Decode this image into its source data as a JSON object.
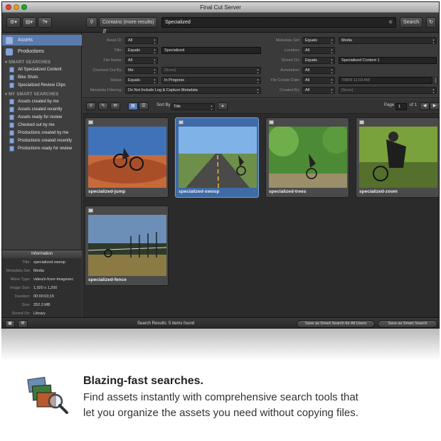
{
  "window": {
    "title": "Final Cut Server"
  },
  "toolbar": {
    "search_mode": "Contains (more results)",
    "search_value": "Specialized",
    "search_button": "Search"
  },
  "sidebar": {
    "items": [
      {
        "label": "Assets",
        "selected": true
      },
      {
        "label": "Productions",
        "selected": false
      }
    ],
    "smart_searches_header": "SMART SEARCHES",
    "smart_searches": [
      "All Specialized Content",
      "Bike Shots",
      "Specialized Review Clips"
    ],
    "my_smart_searches_header": "MY SMART SEARCHES",
    "my_smart_searches": [
      "Assets created by me",
      "Assets created recently",
      "Assets ready for review",
      "Checked out by me",
      "Productions created by me",
      "Productions created recently",
      "Productions ready for review"
    ]
  },
  "info_panel": {
    "header": "Information",
    "rows": [
      {
        "key": "Title:",
        "value": "specialized-swoop"
      },
      {
        "key": "Metadata Set:",
        "value": "Media"
      },
      {
        "key": "Mime Type:",
        "value": "video/x-fcsvr-imagesec"
      },
      {
        "key": "Image Size:",
        "value": "1,920 x 1,200"
      },
      {
        "key": "Duration:",
        "value": "00:00:03;15"
      },
      {
        "key": "Size:",
        "value": "252.3 MB"
      },
      {
        "key": "Stored On:",
        "value": "Library"
      }
    ]
  },
  "filters": {
    "asset_id": {
      "label": "Asset ID:",
      "value": "All"
    },
    "title": {
      "label": "Title:",
      "op": "Equals",
      "value": "Specialized"
    },
    "file_name": {
      "label": "File Name:",
      "value": "All"
    },
    "checked_out_by": {
      "label": "Checked Out By:",
      "op": "Me",
      "value": "[None]"
    },
    "status": {
      "label": "Status:",
      "op": "Equals",
      "value": "In Progress"
    },
    "metadata_filtering": {
      "label": "Metadata Filtering:",
      "value": "Do Not Include Log & Capture Metadata"
    },
    "metadata_set": {
      "label": "Metadata Set:",
      "op": "Equals",
      "value": "Media"
    },
    "location": {
      "label": "Location:",
      "value": "All"
    },
    "stored_on": {
      "label": "Stored On:",
      "op": "Equals",
      "value": "Specialized Content 1"
    },
    "annotation": {
      "label": "Annotation:",
      "value": "All"
    },
    "file_create_date": {
      "label": "File Create Date:",
      "op": "All",
      "value": "7/8/09 11:03 AM"
    },
    "created_by": {
      "label": "Created By:",
      "op": "All",
      "value": "[None]"
    }
  },
  "gridbar": {
    "sort_label": "Sort By",
    "sort_value": "Title",
    "page_label": "Page",
    "page_value": "1",
    "page_of": "of 1"
  },
  "assets": [
    {
      "label": "specialized-jump",
      "selected": false
    },
    {
      "label": "specialized-swoop",
      "selected": true
    },
    {
      "label": "specialized-trees",
      "selected": false
    },
    {
      "label": "specialized-zoom",
      "selected": false
    },
    {
      "label": "specialized-fence",
      "selected": false
    }
  ],
  "statusbar": {
    "results": "Search Results: 5 items found",
    "save_all": "Save as Smart Search for All Users",
    "save": "Save as Smart Search"
  },
  "promo": {
    "headline": "Blazing-fast searches.",
    "line1": "Find assets instantly with comprehensive search tools that",
    "line2": "let you organize the assets you need without copying files."
  },
  "colors": {
    "accent": "#3e6aa6",
    "window_bg": "#3b3b3b"
  }
}
